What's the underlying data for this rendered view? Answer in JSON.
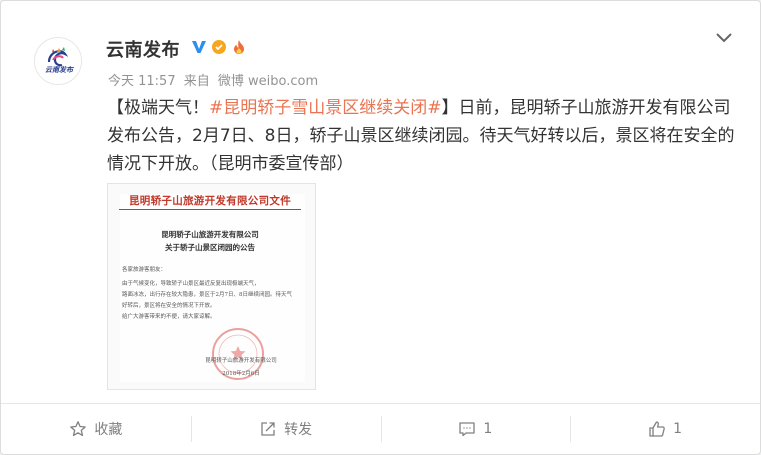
{
  "post": {
    "user_name": "云南发布",
    "avatar_text": "云南发布",
    "time": "今天 11:57",
    "source_prefix": "来自",
    "source": "微博 weibo.com",
    "content": {
      "part1": "【极端天气！",
      "hashtag": "#昆明轿子雪山景区继续关闭#",
      "part2": "】日前，昆明轿子山旅游开发有限公司发布公告，2月7日、8日，轿子山景区继续闭园。待天气好转以后，景区将在安全的情况下开放。（昆明市委宣传部）"
    },
    "colors": {
      "hashtag": "#eb7350",
      "verified": "#2d8ef0",
      "text": "#333333",
      "meta": "#939393"
    }
  },
  "document": {
    "letterhead": "昆明轿子山旅游开发有限公司文件",
    "heading_1": "昆明轿子山旅游开发有限公司",
    "heading_2": "关于轿子山景区闭园的公告",
    "salutation": "各家旅游客朋友：",
    "body_1": "    由于气候变化，导致轿子山景区最近反复出现极端天气，",
    "body_2": "路面冰冻，出行存在较大隐患，景区于2月7日、8日继续闭园。待天气",
    "body_3": "好转后，景区将在安全的情况下开放。",
    "body_4": "    给广大游客带来的不便，请大家谅解。",
    "sign_company": "昆明轿子山旅游开发有限公司",
    "sign_date": "2018年2月6日"
  },
  "actions": {
    "favorite": "收藏",
    "repost": "转发",
    "comment_count": "1",
    "like_count": "1"
  },
  "icons": [
    "avatar-logo-icon",
    "verified-v-icon",
    "gold-medal-icon",
    "fire-icon",
    "chevron-down-icon",
    "star-icon",
    "repost-icon",
    "comment-icon",
    "thumbs-up-icon",
    "red-seal-icon"
  ]
}
